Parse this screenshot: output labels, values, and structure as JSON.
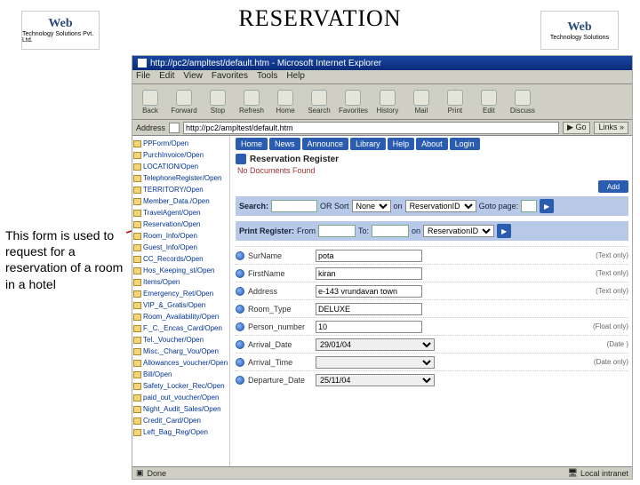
{
  "slide": {
    "title": "RESERVATION",
    "description": "This form is used to request for a reservation of a room in a hotel"
  },
  "logo": {
    "brand": "Web",
    "tag_left": "Technology Solutions Pvt. Ltd.",
    "tag_right": "Technology Solutions"
  },
  "ie": {
    "window_title": "http://pc2/ampltest/default.htm - Microsoft Internet Explorer",
    "menus": [
      "File",
      "Edit",
      "View",
      "Favorites",
      "Tools",
      "Help"
    ],
    "tools": [
      "Back",
      "Forward",
      "Stop",
      "Refresh",
      "Home",
      "Search",
      "Favorites",
      "History",
      "Mail",
      "Print",
      "Edit",
      "Discuss"
    ],
    "addr_label": "Address",
    "url": "http://pc2/ampltest/default.htm",
    "go": "Go",
    "links": "Links »",
    "status": "Done",
    "zone": "Local intranet"
  },
  "app": {
    "tabs": [
      "Home",
      "News",
      "Announce",
      "Library",
      "Help",
      "About",
      "Login"
    ],
    "header": "Reservation Register",
    "nodoc": "No Documents Found",
    "add": "Add",
    "search": {
      "label": "Search:",
      "or_sort": "OR Sort",
      "sort_val": "None",
      "on": "on",
      "on_val": "ReservationID",
      "goto": "Goto page:"
    },
    "print": {
      "label": "Print Register:",
      "from": "From",
      "to": "To:",
      "on": "on",
      "on_val": "ReservationID"
    },
    "fields": [
      {
        "label": "SurName",
        "value": "pota",
        "hint": "(Text only)"
      },
      {
        "label": "FirstName",
        "value": "kiran",
        "hint": "(Text only)"
      },
      {
        "label": "Address",
        "value": "e-143 vrundavan town",
        "hint": "(Text only)"
      },
      {
        "label": "Room_Type",
        "value": "DELUXE",
        "hint": ""
      },
      {
        "label": "Person_number",
        "value": "10",
        "hint": "(Float only)"
      },
      {
        "label": "Arrival_Date",
        "value": "29/01/04",
        "hint": "(Date )",
        "select": true
      },
      {
        "label": "Arrival_Time",
        "value": "",
        "hint": "(Date only)",
        "select": true
      },
      {
        "label": "Departure_Date",
        "value": "25/11/04",
        "hint": "",
        "select": true
      }
    ],
    "sidebar": [
      "PPForm/Open",
      "PurchInvoice/Open",
      "LOCATION/Open",
      "TelephoneRegister/Open",
      "TERRITORY/Open",
      "Member_Data./Open",
      "TravelAgent/Open",
      "Reservation/Open",
      "Room_Info/Open",
      "Guest_Info/Open",
      "CC_Records/Open",
      "Hos_Keeping_st/Open",
      "Items/Open",
      "Emergency_Ret/Open",
      "VIP_&_Gratis/Open",
      "Room_Availability/Open",
      "F._C._Encas_Card/Open",
      "Tel._Voucher/Open",
      "Misc._Charg_Vou/Open",
      "Allowances_voucher/Open",
      "Bill/Open",
      "Safety_Locker_Rec/Open",
      "paid_out_voucher/Open",
      "Night_Audit_Sales/Open",
      "Credit_Card/Open",
      "Left_Bag_Reg/Open"
    ]
  }
}
